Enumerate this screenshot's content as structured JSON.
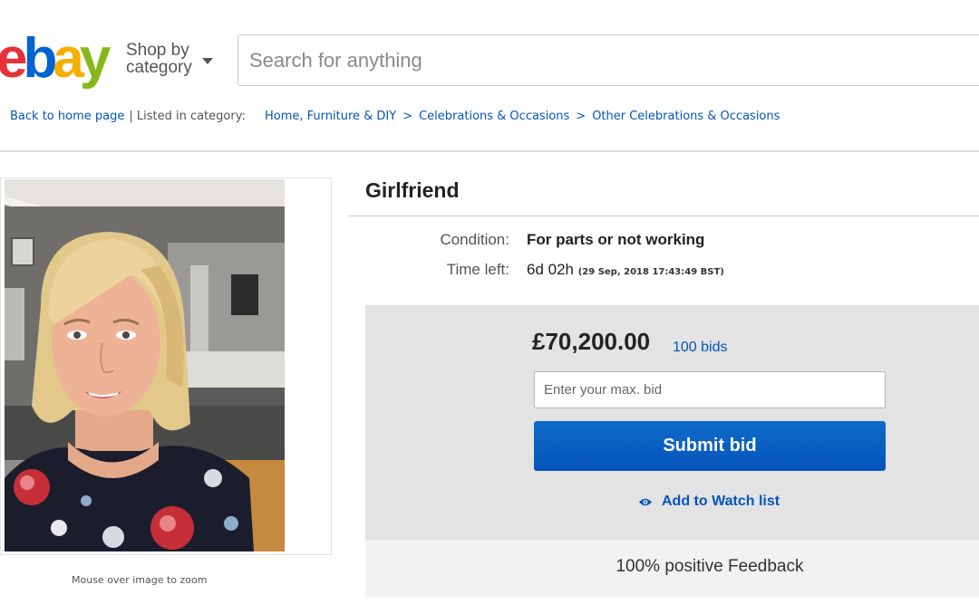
{
  "header": {
    "logo_letters": [
      {
        "char": "e",
        "color": "#e53238"
      },
      {
        "char": "b",
        "color": "#0064d2"
      },
      {
        "char": "a",
        "color": "#f5af02"
      },
      {
        "char": "y",
        "color": "#86b817"
      }
    ],
    "shop_by_line1": "Shop by",
    "shop_by_line2": "category",
    "search_placeholder": "Search for anything"
  },
  "breadcrumb": {
    "back_label": "Back to home page",
    "listed_label": "| Listed in category:",
    "categories": [
      "Home, Furniture & DIY",
      "Celebrations & Occasions",
      "Other Celebrations & Occasions"
    ],
    "separator": ">"
  },
  "item": {
    "zoom_hint": "Mouse over image to zoom",
    "title": "Girlfriend",
    "condition_label": "Condition:",
    "condition_value": "For parts or not working",
    "time_label": "Time left:",
    "time_value": "6d 02h",
    "time_end": "(29 Sep, 2018   17:43:49 BST)"
  },
  "bidding": {
    "price": "£70,200.00",
    "bids_link": "100 bids",
    "bid_placeholder": "Enter your max. bid",
    "submit_label": "Submit bid",
    "watch_label": "Add to Watch list",
    "feedback": "100% positive Feedback"
  },
  "colors": {
    "link": "#0654ba",
    "submit_button": "#0654ba",
    "bid_panel": "#e3e3e3"
  }
}
